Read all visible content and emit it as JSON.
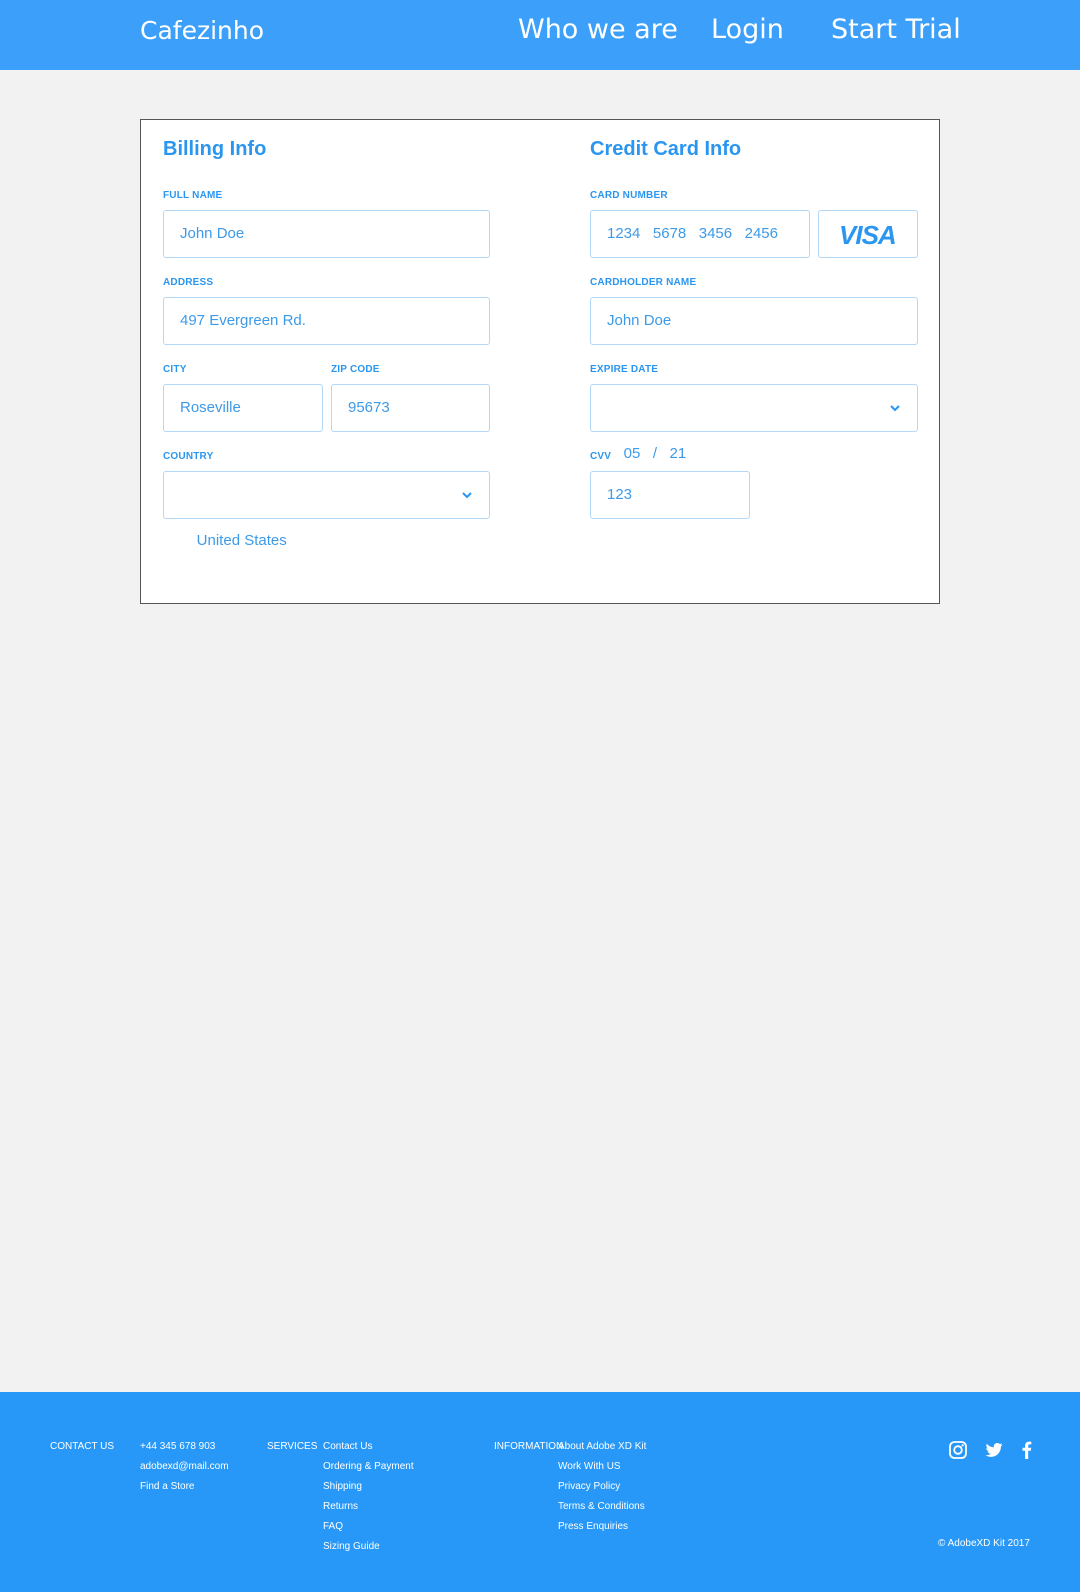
{
  "header": {
    "brand": "Cafezinho",
    "nav": [
      "Who we are",
      "Login",
      "Start Trial"
    ]
  },
  "billing": {
    "title": "Billing Info",
    "full_name_label": "FULL NAME",
    "full_name_value": "John Doe",
    "address_label": "ADDRESS",
    "address_value": "497 Evergreen Rd.",
    "city_label": "CITY",
    "city_value": "Roseville",
    "zip_label": "ZIP CODE",
    "zip_value": "95673",
    "country_label": "COUNTRY",
    "country_value": "United States"
  },
  "credit": {
    "title": "Credit Card Info",
    "card_number_label": "CARD NUMBER",
    "card_number_value": "1234   5678   3456   2456",
    "card_brand": "VISA",
    "holder_label": "CARDHOLDER NAME",
    "holder_value": "John Doe",
    "expire_label": "EXPIRE DATE",
    "expire_value": "05   /   21",
    "cvv_label": "CVV",
    "cvv_value": "123"
  },
  "footer": {
    "contact_heading": "CONTACT US",
    "contact_items": [
      "+44 345 678 903",
      "adobexd@mail.com",
      "Find a Store"
    ],
    "services_heading": "SERVICES",
    "services_items": [
      "Contact Us",
      "Ordering & Payment",
      "Shipping",
      "Returns",
      "FAQ",
      "Sizing Guide"
    ],
    "information_heading": "INFORMATION",
    "information_items": [
      "About Adobe XD Kit",
      "Work With US",
      "Privacy Policy",
      "Terms & Conditions",
      "Press Enquiries"
    ],
    "social_icons": [
      "instagram-icon",
      "twitter-icon",
      "facebook-icon"
    ],
    "copyright": "© AdobeXD Kit 2017"
  },
  "colors": {
    "header_bg": "#3ca0fa",
    "accent": "#2a96f0",
    "footer_bg": "#2898f8",
    "page_bg": "#f2f2f2"
  }
}
